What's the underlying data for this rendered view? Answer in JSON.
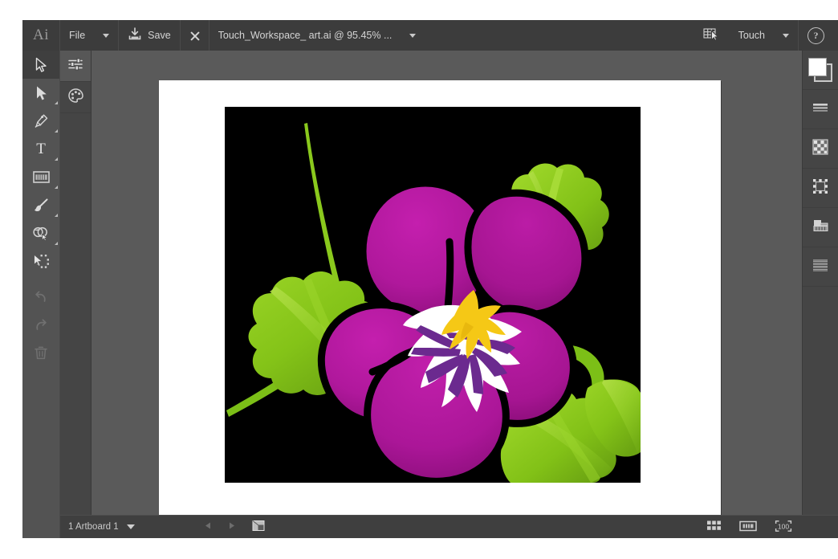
{
  "app": {
    "logo": "Ai",
    "name": "Adobe Illustrator"
  },
  "topbar": {
    "file_menu": "File",
    "save_label": "Save",
    "close_icon": "close-icon",
    "document_title": "Touch_Workspace_ art.ai @ 95.45% ...",
    "workspace_icon": "touch-workspace-icon",
    "workspace_label": "Touch",
    "help_label": "?"
  },
  "tools": [
    {
      "name": "selection-tool",
      "icon": "arrow-outline-icon",
      "active": true,
      "flyout": false
    },
    {
      "name": "direct-selection-tool",
      "icon": "arrow-solid-icon",
      "active": false,
      "flyout": true
    },
    {
      "name": "pen-tool",
      "icon": "pen-icon",
      "active": false,
      "flyout": true
    },
    {
      "name": "type-tool",
      "icon": "type-icon",
      "active": false,
      "flyout": true
    },
    {
      "name": "artboard-tool",
      "icon": "artboard-icon",
      "active": false,
      "flyout": true
    },
    {
      "name": "paintbrush-tool",
      "icon": "paintbrush-icon",
      "active": false,
      "flyout": true
    },
    {
      "name": "shape-builder-tool",
      "icon": "shape-builder-icon",
      "active": false,
      "flyout": true
    },
    {
      "name": "free-transform-tool",
      "icon": "free-transform-icon",
      "active": false,
      "flyout": false
    },
    {
      "name": "undo-button",
      "icon": "undo-arrow-icon",
      "active": false,
      "flyout": false
    },
    {
      "name": "redo-button",
      "icon": "redo-arrow-icon",
      "active": false,
      "flyout": false
    },
    {
      "name": "delete-button",
      "icon": "trash-icon",
      "active": false,
      "flyout": false
    }
  ],
  "panel_column": [
    {
      "name": "properties-panel-button",
      "icon": "sliders-icon",
      "active": true
    },
    {
      "name": "color-panel-button",
      "icon": "color-palette-icon",
      "active": false
    }
  ],
  "right_panel": [
    {
      "name": "fill-stroke-swatches",
      "icon": "fill-stroke-icon"
    },
    {
      "name": "stroke-panel-button",
      "icon": "stroke-lines-icon"
    },
    {
      "name": "transparency-panel-button",
      "icon": "checkerboard-icon"
    },
    {
      "name": "transform-panel-button",
      "icon": "transform-handles-icon"
    },
    {
      "name": "layers-panel-button",
      "icon": "layers-icon"
    },
    {
      "name": "align-panel-button",
      "icon": "align-lines-icon"
    }
  ],
  "statusbar": {
    "artboard_label": "1 Artboard 1",
    "prev_artboard_icon": "triangle-left-icon",
    "next_artboard_icon": "triangle-right-icon",
    "artboard_options_icon": "artboard-navigator-icon",
    "view_icons": [
      {
        "name": "grid-view-button",
        "icon": "grid-icon"
      },
      {
        "name": "fit-artboard-button",
        "icon": "fit-artboard-icon"
      },
      {
        "name": "zoom-level-button",
        "icon": "zoom-100-icon"
      }
    ]
  },
  "artwork": {
    "title": "Pansy flower illustration",
    "background_color": "#000000",
    "colors": {
      "petal_magenta": "#b0189c",
      "petal_magenta_dark": "#8f0f7e",
      "petal_magenta_light": "#c41fae",
      "leaf_green": "#84c318",
      "leaf_green_light": "#9ad426",
      "leaf_green_dark": "#5f9410",
      "stem_green": "#7bbf18",
      "center_yellow": "#f5c816",
      "center_purple": "#6b2a8f",
      "petal_white": "#ffffff",
      "outline_black": "#000000"
    }
  }
}
